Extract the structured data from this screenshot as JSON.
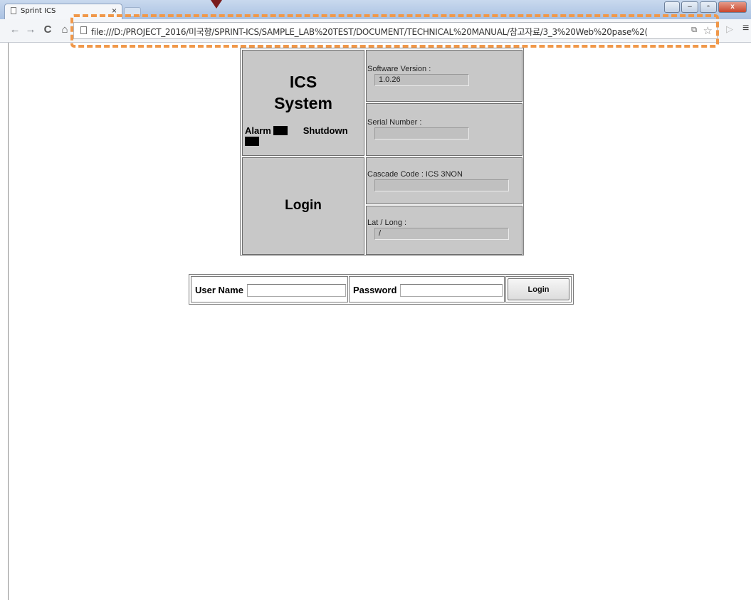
{
  "browser": {
    "tab_title": "Sprint ICS",
    "tab_close": "×",
    "url": "file:///D:/PROJECT_2016/미국향/SPRINT-ICS/SAMPLE_LAB%20TEST/DOCUMENT/TECHNICAL%20MANUAL/참고자료/3_3%20Web%20pase%2(",
    "nav": {
      "back": "←",
      "forward": "→",
      "reload": "C",
      "home": "⌂"
    },
    "window_buttons": {
      "minimize": "–",
      "maximize": "▫",
      "close": "x"
    },
    "menu": "≡",
    "star": "☆"
  },
  "ics": {
    "title_line1": "ICS",
    "title_line2": "System",
    "alarm_label": "Alarm",
    "shutdown_label": "Shutdown",
    "software_version_label": "Software Version :",
    "software_version_value": "1.0.26",
    "serial_number_label": "Serial Number :",
    "serial_number_value": "",
    "cascade_code_label": "Cascade Code : ICS 3NON",
    "cascade_code_value": "",
    "lat_long_label": "Lat / Long :",
    "lat_long_value": "/",
    "login_title": "Login"
  },
  "login_form": {
    "user_name_label": "User Name",
    "user_name_value": "",
    "password_label": "Password",
    "password_value": "",
    "login_button": "Login"
  },
  "colors": {
    "panel_gray": "#c8c8c8",
    "annotation_orange": "#f0984a",
    "annotation_arrow": "#7a1b1b"
  }
}
